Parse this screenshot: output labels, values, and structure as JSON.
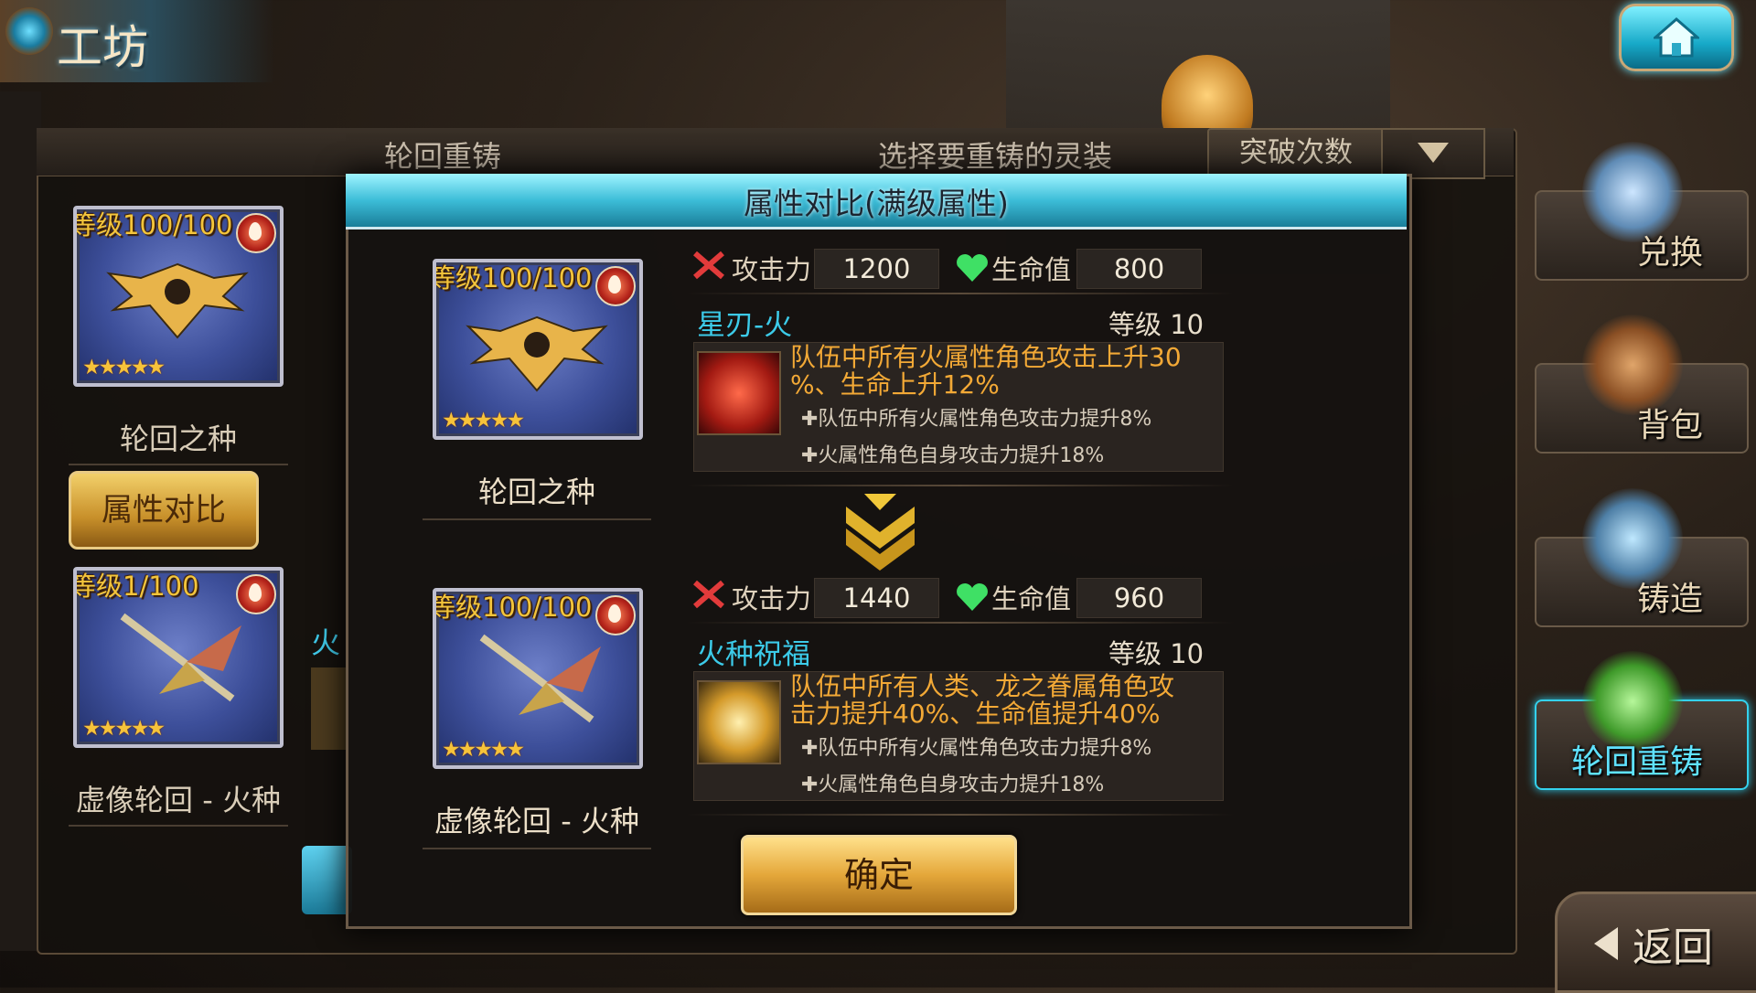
{
  "header": {
    "title": "工坊"
  },
  "background": {
    "tab_reforge": "轮回重铸",
    "tab_select": "选择要重铸的灵装",
    "breaks_label": "突破次数",
    "left_card_top": {
      "level": "等级100/100",
      "name": "轮回之种",
      "stars": "★★★★★"
    },
    "compare_button": "属性对比",
    "left_card_bottom": {
      "level": "等级1/100",
      "name": "虚像轮回 - 火种",
      "stars": "★★★★★"
    },
    "partial_text": "火"
  },
  "modal": {
    "title": "属性对比(满级属性)",
    "before": {
      "card": {
        "level": "等级100/100",
        "name": "轮回之种",
        "stars": "★★★★★"
      },
      "attack_label": "攻击力",
      "attack_value": "1200",
      "hp_label": "生命值",
      "hp_value": "800",
      "skill_name": "星刃-火",
      "skill_level": "等级 10",
      "skill_main_line1": "队伍中所有火属性角色攻击上升30",
      "skill_main_line2": "%、生命上升12%",
      "skill_sub1": "✚队伍中所有火属性角色攻击力提升8%",
      "skill_sub2": "✚火属性角色自身攻击力提升18%"
    },
    "after": {
      "card": {
        "level": "等级100/100",
        "name": "虚像轮回 - 火种",
        "stars": "★★★★★"
      },
      "attack_label": "攻击力",
      "attack_value": "1440",
      "hp_label": "生命值",
      "hp_value": "960",
      "skill_name": "火种祝福",
      "skill_level": "等级 10",
      "skill_main_line1": "队伍中所有人类、龙之眷属角色攻",
      "skill_main_line2": "击力提升40%、生命值提升40%",
      "skill_sub1": "✚队伍中所有火属性角色攻击力提升8%",
      "skill_sub2": "✚火属性角色自身攻击力提升18%"
    },
    "confirm": "确定"
  },
  "side_menu": {
    "exchange": "兑换",
    "bag": "背包",
    "forge": "铸造",
    "reforge": "轮回重铸",
    "back": "返回"
  }
}
